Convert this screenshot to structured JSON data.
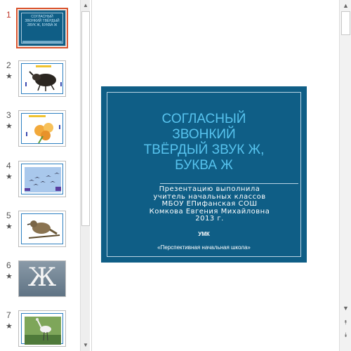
{
  "thumbnails": [
    {
      "number": "1",
      "star": "",
      "title_text": "СОГЛАСНЫЙ ЗВОНКИЙ ТВЁРДЫЙ ЗВУК Ж, БУКВА Ж"
    },
    {
      "number": "2",
      "star": "★"
    },
    {
      "number": "3",
      "star": "★"
    },
    {
      "number": "4",
      "star": "★"
    },
    {
      "number": "5",
      "star": "★"
    },
    {
      "number": "6",
      "star": "★",
      "letter": "Ж"
    },
    {
      "number": "7",
      "star": "★"
    }
  ],
  "slide": {
    "title_lines": [
      "СОГЛАСНЫЙ",
      "ЗВОНКИЙ",
      "ТВЁРДЫЙ ЗВУК Ж,",
      "БУКВА Ж"
    ],
    "author_lines": [
      "Презентацию выполнила",
      "учитель начальных классов",
      "МБОУ ЕПифанская СОШ",
      "Комкова Евгения Михайловна",
      "2013 г."
    ],
    "umk": "УМК",
    "school": "«Перспективная начальная школа»"
  },
  "scrollbar": {
    "up": "▲",
    "down": "▼",
    "prev_slide": "⯭",
    "next_slide": "⯯"
  },
  "colors": {
    "slide_bg": "#0f5e86",
    "title": "#57c3ee",
    "active_thumb_border": "#d9532c"
  }
}
